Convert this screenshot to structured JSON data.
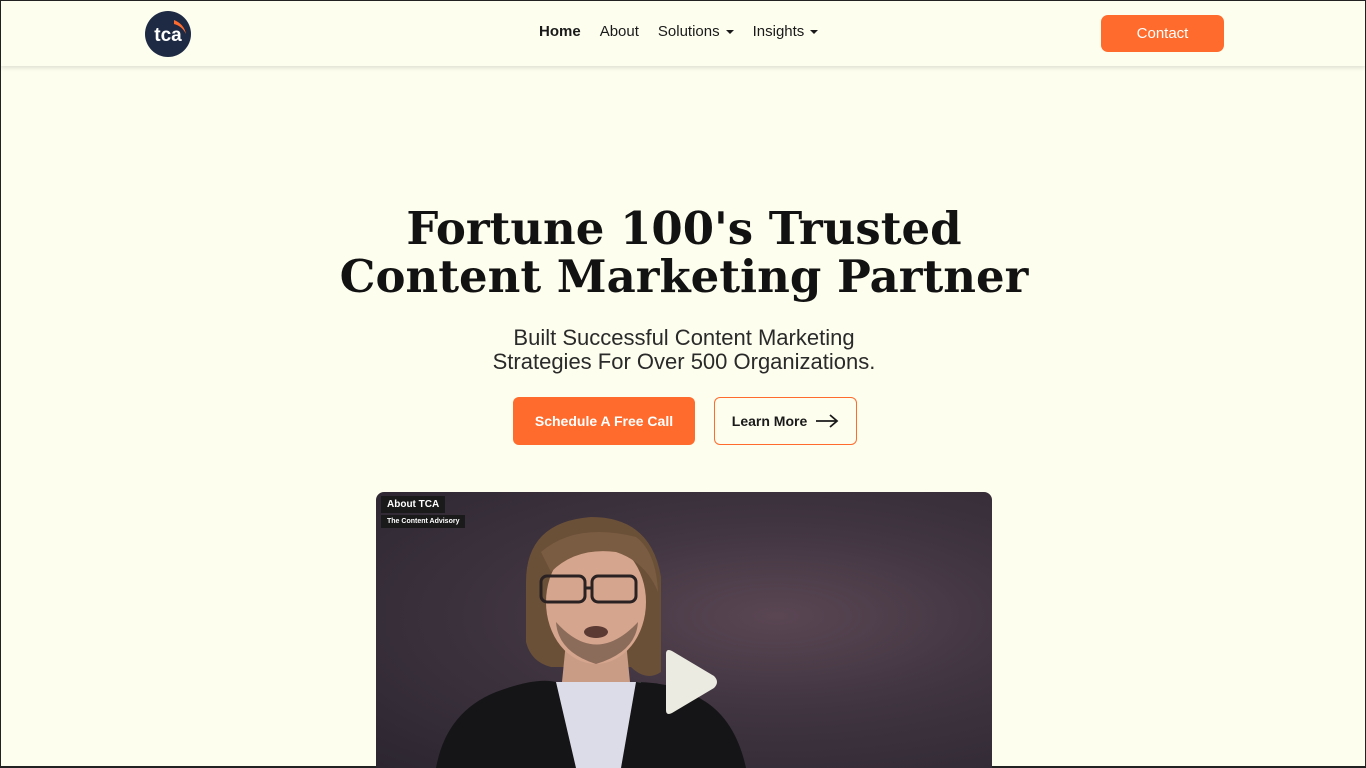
{
  "header": {
    "logo_text": "tca",
    "nav": [
      {
        "label": "Home",
        "active": true,
        "dropdown": false
      },
      {
        "label": "About",
        "active": false,
        "dropdown": false
      },
      {
        "label": "Solutions",
        "active": false,
        "dropdown": true
      },
      {
        "label": "Insights",
        "active": false,
        "dropdown": true
      }
    ],
    "contact_label": "Contact"
  },
  "hero": {
    "title_line1": "Fortune 100's Trusted",
    "title_line2": "Content Marketing Partner",
    "subtitle_line1": "Built Successful Content Marketing",
    "subtitle_line2": "Strategies For Over 500 Organizations.",
    "primary_cta": "Schedule A Free Call",
    "secondary_cta": "Learn More",
    "secondary_cta_icon": "arrow-right-icon"
  },
  "video": {
    "title": "About TCA",
    "channel": "The Content Advisory",
    "play_icon": "play-icon"
  },
  "colors": {
    "accent": "#ff6b2c",
    "background": "#fefeef",
    "logo_bg": "#1e2a44"
  }
}
